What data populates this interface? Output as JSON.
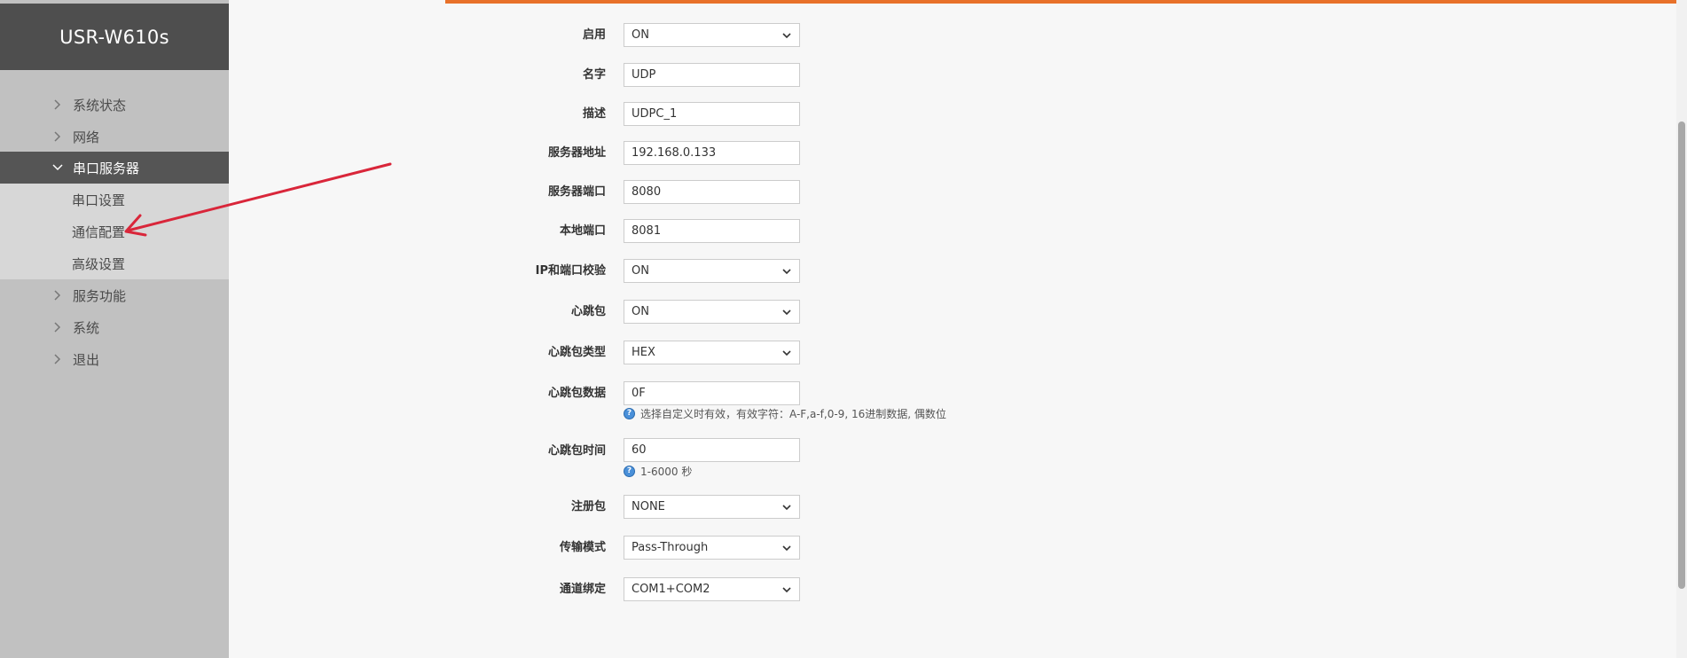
{
  "app": {
    "title": "USR-W610s"
  },
  "sidebar": {
    "items": [
      {
        "label": "系统状态"
      },
      {
        "label": "网络"
      },
      {
        "label": "串口服务器"
      },
      {
        "label": "服务功能"
      },
      {
        "label": "系统"
      },
      {
        "label": "退出"
      }
    ],
    "submenu": [
      {
        "label": "串口设置"
      },
      {
        "label": "通信配置"
      },
      {
        "label": "高级设置"
      }
    ]
  },
  "form": {
    "enable": {
      "label": "启用",
      "value": "ON"
    },
    "name": {
      "label": "名字",
      "value": "UDP"
    },
    "desc": {
      "label": "描述",
      "value": "UDPC_1"
    },
    "server_addr": {
      "label": "服务器地址",
      "value": "192.168.0.133"
    },
    "server_port": {
      "label": "服务器端口",
      "value": "8080"
    },
    "local_port": {
      "label": "本地端口",
      "value": "8081"
    },
    "ip_port_check": {
      "label": "IP和端口校验",
      "value": "ON"
    },
    "heartbeat": {
      "label": "心跳包",
      "value": "ON"
    },
    "heartbeat_type": {
      "label": "心跳包类型",
      "value": "HEX"
    },
    "heartbeat_data": {
      "label": "心跳包数据",
      "value": "0F",
      "hint": "选择自定义时有效，有效字符：A-F,a-f,0-9, 16进制数据, 偶数位"
    },
    "heartbeat_time": {
      "label": "心跳包时间",
      "value": "60",
      "hint": "1-6000 秒"
    },
    "register": {
      "label": "注册包",
      "value": "NONE"
    },
    "transfer_mode": {
      "label": "传输模式",
      "value": "Pass-Through"
    },
    "channel_bind": {
      "label": "通道绑定",
      "value": "COM1+COM2"
    }
  },
  "colors": {
    "accent": "#e8712a",
    "sidebar_bg": "#c1c1c1",
    "logo_bg": "#4e4e4e",
    "active_bg": "#555555",
    "annotation": "#d9263a"
  },
  "icons": {
    "nav_expand": "chevron-right-icon",
    "nav_collapse": "chevron-down-icon",
    "help": "question-circle-icon"
  }
}
